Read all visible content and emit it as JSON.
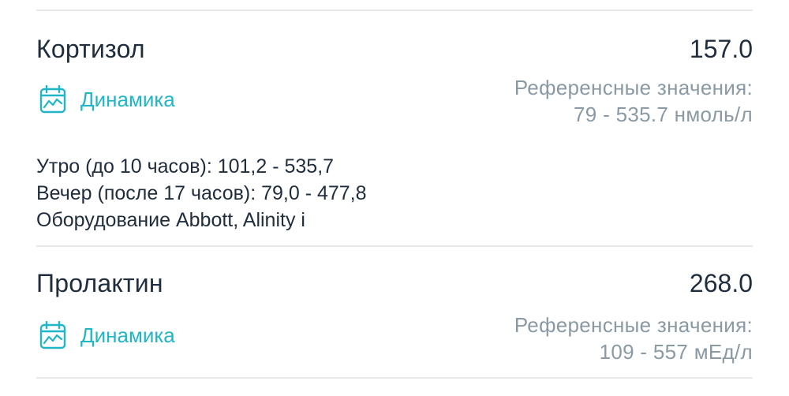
{
  "colors": {
    "accent": "#1fb6c8",
    "text_primary": "#1f2d3d",
    "text_secondary": "#8a9aa4",
    "divider": "#e6e8ea"
  },
  "tests": [
    {
      "name": "Кортизол",
      "value": "157.0",
      "dynamics_label": "Динамика",
      "dynamics_icon": "calendar-chart-icon",
      "reference_label": "Референсные значения:",
      "reference_range": "79 - 535.7 нмоль/л",
      "notes": [
        "Утро (до 10 часов): 101,2 - 535,7",
        "Вечер (после 17 часов): 79,0 - 477,8",
        "Оборудование Abbott, Alinity i"
      ]
    },
    {
      "name": "Пролактин",
      "value": "268.0",
      "dynamics_label": "Динамика",
      "dynamics_icon": "calendar-chart-icon",
      "reference_label": "Референсные значения:",
      "reference_range": "109 - 557 мЕд/л"
    }
  ]
}
